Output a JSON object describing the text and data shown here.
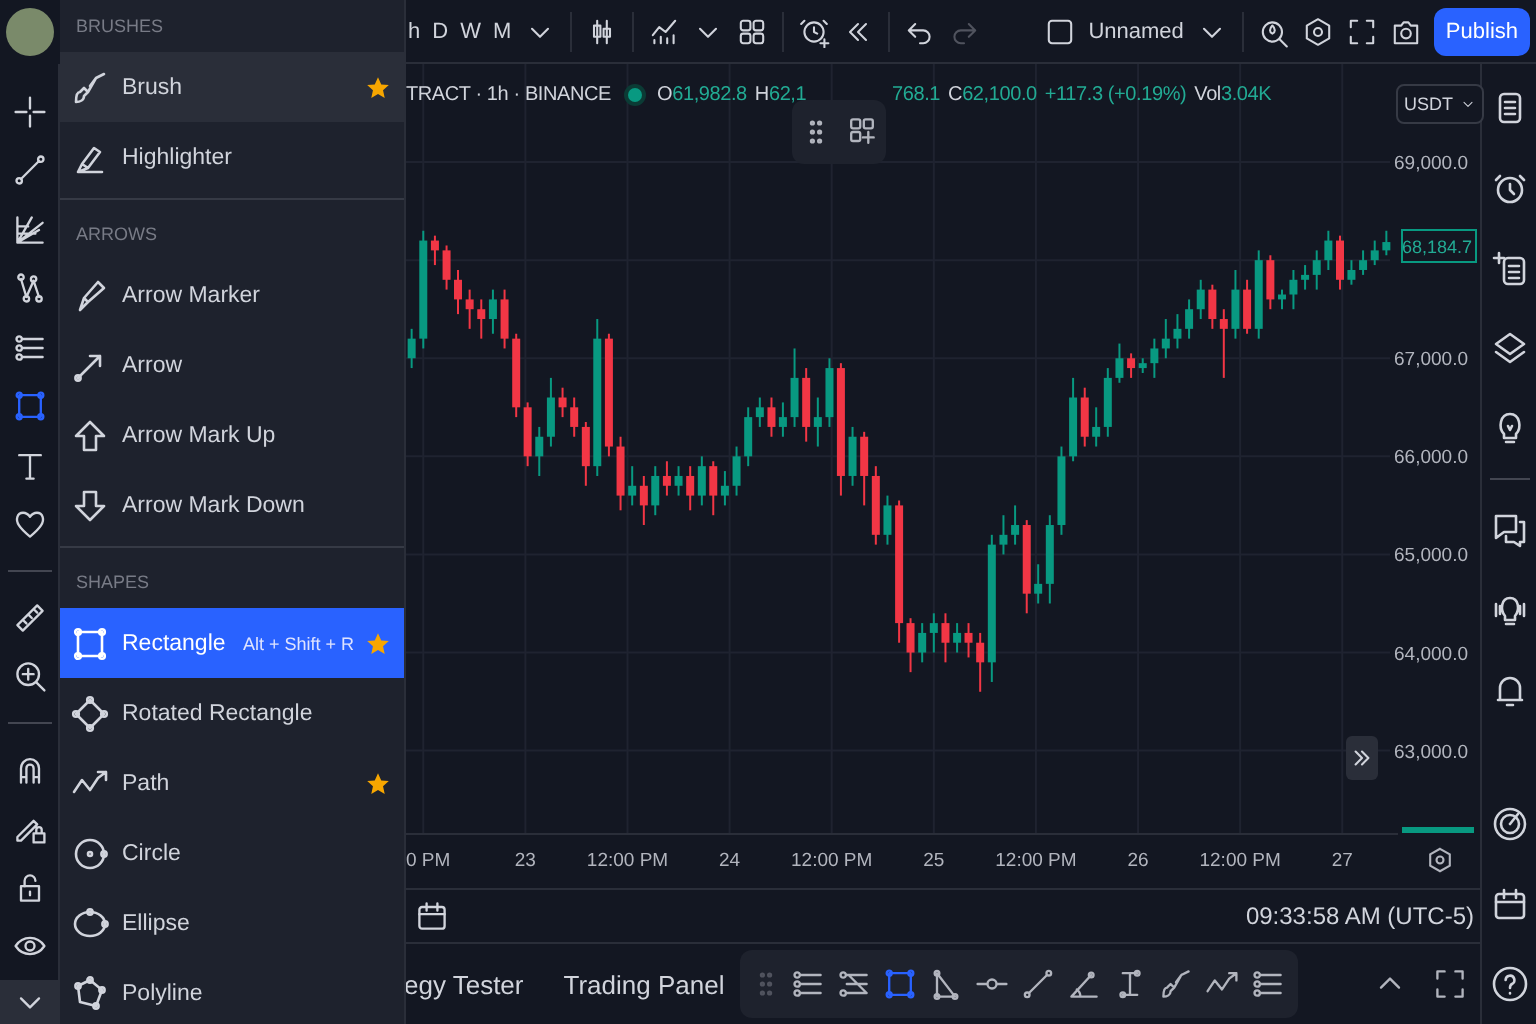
{
  "top_toolbar": {
    "intervals": [
      {
        "label": "h"
      },
      {
        "label": "D"
      },
      {
        "label": "W"
      },
      {
        "label": "M"
      }
    ],
    "history": [
      {
        "kind": "undo",
        "disabled": false
      },
      {
        "kind": "redo",
        "disabled": true
      }
    ],
    "layout_name": "Unnamed",
    "publish": "Publish"
  },
  "drawing_menu": {
    "sections": [
      {
        "title": "BRUSHES",
        "items": [
          {
            "label": "Brush",
            "favorite": true,
            "selected": false,
            "hovered": true
          },
          {
            "label": "Highlighter",
            "favorite": false,
            "selected": false,
            "hovered": false
          }
        ]
      },
      {
        "title": "ARROWS",
        "items": [
          {
            "label": "Arrow Marker",
            "favorite": false,
            "selected": false,
            "hovered": false
          },
          {
            "label": "Arrow",
            "favorite": false,
            "selected": false,
            "hovered": false
          },
          {
            "label": "Arrow Mark Up",
            "favorite": false,
            "selected": false,
            "hovered": false
          },
          {
            "label": "Arrow Mark Down",
            "favorite": false,
            "selected": false,
            "hovered": false
          }
        ]
      },
      {
        "title": "SHAPES",
        "items": [
          {
            "label": "Rectangle",
            "shortcut": "Alt + Shift + R",
            "favorite": true,
            "selected": true,
            "hovered": false
          },
          {
            "label": "Rotated Rectangle",
            "favorite": false,
            "selected": false,
            "hovered": false
          },
          {
            "label": "Path",
            "favorite": true,
            "selected": false,
            "hovered": false
          },
          {
            "label": "Circle",
            "favorite": false,
            "selected": false,
            "hovered": false
          },
          {
            "label": "Ellipse",
            "favorite": false,
            "selected": false,
            "hovered": false
          },
          {
            "label": "Polyline",
            "favorite": false,
            "selected": false,
            "hovered": false
          }
        ]
      }
    ]
  },
  "left_toolbar": {
    "tools": [
      {
        "selected": false
      },
      {
        "selected": false
      },
      {
        "selected": false
      },
      {
        "selected": false
      },
      {
        "selected": false
      },
      {
        "selected": true
      },
      {
        "selected": false
      },
      {
        "selected": false
      },
      {
        "selected": false
      },
      {
        "selected": false
      },
      {
        "selected": false
      },
      {
        "selected": false
      },
      {
        "selected": false
      },
      {
        "selected": false
      }
    ]
  },
  "legend": {
    "symbol": "TRACT · 1h · BINANCE",
    "fields_before": [
      {
        "label": "O",
        "value": "61,982.8"
      },
      {
        "label": "H",
        "value": "62,1"
      }
    ],
    "fields_after": [
      {
        "value": "768.1"
      },
      {
        "label": "C",
        "value": "62,100.0"
      },
      {
        "value": "+117.3 (+0.19%)"
      },
      {
        "label": "Vol",
        "value": "3.04K"
      }
    ]
  },
  "currency": "USDT",
  "last_price": "68,184.7",
  "chart": {
    "chart_data": {
      "type": "candlestick",
      "x": [
        22.443,
        22.5,
        22.557,
        22.614,
        22.67,
        22.727,
        22.784,
        22.841,
        22.898,
        22.955,
        23.011,
        23.068,
        23.125,
        23.182,
        23.239,
        23.296,
        23.352,
        23.409,
        23.466,
        23.523,
        23.58,
        23.636,
        23.693,
        23.75,
        23.807,
        23.864,
        23.92,
        23.977,
        24.034,
        24.091,
        24.148,
        24.205,
        24.261,
        24.318,
        24.375,
        24.432,
        24.489,
        24.545,
        24.602,
        24.659,
        24.716,
        24.773,
        24.83,
        24.886,
        24.943,
        25,
        25.057,
        25.114,
        25.17,
        25.227,
        25.284,
        25.341,
        25.398,
        25.455,
        25.511,
        25.568,
        25.625,
        25.682,
        25.739,
        25.795,
        25.852,
        25.909,
        25.966,
        26.023,
        26.08,
        26.136,
        26.193,
        26.25,
        26.307,
        26.364,
        26.42,
        26.477,
        26.534,
        26.591,
        26.648,
        26.705,
        26.761,
        26.818,
        26.875,
        26.932,
        26.989,
        27.045,
        27.102,
        27.159,
        27.216
      ],
      "ohlc": [
        [
          67000,
          67300,
          66900,
          67200
        ],
        [
          67200,
          68300,
          67100,
          68200
        ],
        [
          68200,
          68250,
          67950,
          68100
        ],
        [
          68100,
          68150,
          67700,
          67800
        ],
        [
          67800,
          67900,
          67450,
          67600
        ],
        [
          67600,
          67700,
          67300,
          67500
        ],
        [
          67500,
          67600,
          67200,
          67400
        ],
        [
          67400,
          67700,
          67250,
          67600
        ],
        [
          67600,
          67700,
          67100,
          67200
        ],
        [
          67200,
          67250,
          66400,
          66500
        ],
        [
          66500,
          66550,
          65900,
          66000
        ],
        [
          66000,
          66300,
          65800,
          66200
        ],
        [
          66200,
          66800,
          66100,
          66600
        ],
        [
          66600,
          66700,
          66400,
          66500
        ],
        [
          66500,
          66600,
          66200,
          66300
        ],
        [
          66300,
          66350,
          65700,
          65900
        ],
        [
          65900,
          67400,
          65800,
          67200
        ],
        [
          67200,
          67250,
          66000,
          66100
        ],
        [
          66100,
          66200,
          65450,
          65600
        ],
        [
          65600,
          65900,
          65500,
          65700
        ],
        [
          65700,
          65800,
          65300,
          65500
        ],
        [
          65500,
          65900,
          65400,
          65800
        ],
        [
          65800,
          65950,
          65600,
          65700
        ],
        [
          65700,
          65900,
          65600,
          65800
        ],
        [
          65800,
          65900,
          65450,
          65600
        ],
        [
          65600,
          66000,
          65500,
          65900
        ],
        [
          65900,
          65950,
          65400,
          65600
        ],
        [
          65600,
          65850,
          65500,
          65700
        ],
        [
          65700,
          66100,
          65600,
          66000
        ],
        [
          66000,
          66500,
          65900,
          66400
        ],
        [
          66400,
          66600,
          66300,
          66500
        ],
        [
          66500,
          66600,
          66200,
          66300
        ],
        [
          66300,
          66550,
          66200,
          66400
        ],
        [
          66400,
          67100,
          66300,
          66800
        ],
        [
          66800,
          66900,
          66150,
          66300
        ],
        [
          66300,
          66600,
          66100,
          66400
        ],
        [
          66400,
          67000,
          66300,
          66900
        ],
        [
          66900,
          66950,
          65600,
          65800
        ],
        [
          65800,
          66300,
          65700,
          66200
        ],
        [
          66200,
          66250,
          65500,
          65800
        ],
        [
          65800,
          65900,
          65100,
          65200
        ],
        [
          65200,
          65600,
          65100,
          65500
        ],
        [
          65500,
          65550,
          64100,
          64300
        ],
        [
          64300,
          64350,
          63800,
          64000
        ],
        [
          64000,
          64300,
          63900,
          64200
        ],
        [
          64200,
          64400,
          64000,
          64300
        ],
        [
          64300,
          64400,
          63900,
          64100
        ],
        [
          64100,
          64300,
          64000,
          64200
        ],
        [
          64200,
          64300,
          63950,
          64100
        ],
        [
          64100,
          64200,
          63600,
          63900
        ],
        [
          63900,
          65200,
          63700,
          65100
        ],
        [
          65100,
          65400,
          65000,
          65200
        ],
        [
          65200,
          65500,
          65100,
          65300
        ],
        [
          65300,
          65350,
          64400,
          64600
        ],
        [
          64600,
          64900,
          64500,
          64700
        ],
        [
          64700,
          65400,
          64500,
          65300
        ],
        [
          65300,
          66100,
          65200,
          66000
        ],
        [
          66000,
          66800,
          65950,
          66600
        ],
        [
          66600,
          66700,
          66100,
          66200
        ],
        [
          66200,
          66500,
          66100,
          66300
        ],
        [
          66300,
          66900,
          66200,
          66800
        ],
        [
          66800,
          67150,
          66750,
          67000
        ],
        [
          67000,
          67050,
          66800,
          66900
        ],
        [
          66900,
          67000,
          66850,
          66950
        ],
        [
          66950,
          67200,
          66800,
          67100
        ],
        [
          67100,
          67400,
          67000,
          67200
        ],
        [
          67200,
          67450,
          67100,
          67300
        ],
        [
          67300,
          67600,
          67200,
          67500
        ],
        [
          67500,
          67800,
          67400,
          67700
        ],
        [
          67700,
          67750,
          67300,
          67400
        ],
        [
          67400,
          67500,
          66800,
          67300
        ],
        [
          67300,
          67900,
          67200,
          67700
        ],
        [
          67700,
          67800,
          67250,
          67300
        ],
        [
          67300,
          68100,
          67200,
          68000
        ],
        [
          68000,
          68050,
          67500,
          67600
        ],
        [
          67600,
          67700,
          67500,
          67650
        ],
        [
          67650,
          67900,
          67500,
          67800
        ],
        [
          67800,
          67950,
          67700,
          67850
        ],
        [
          67850,
          68100,
          67700,
          68000
        ],
        [
          68000,
          68300,
          67900,
          68200
        ],
        [
          68200,
          68250,
          67700,
          67800
        ],
        [
          67800,
          68000,
          67750,
          67900
        ],
        [
          67900,
          68100,
          67850,
          68000
        ],
        [
          68000,
          68200,
          67950,
          68100
        ],
        [
          68100,
          68300,
          68050,
          68184.7
        ]
      ],
      "grid": true,
      "xlim": [
        22.386,
        27.273
      ],
      "ylim": [
        62150,
        70000
      ],
      "xticks": [
        {
          "value": 23,
          "label": "23"
        },
        {
          "value": 24,
          "label": "24"
        },
        {
          "value": 25,
          "label": "25"
        },
        {
          "value": 26,
          "label": "26"
        },
        {
          "value": 27,
          "label": "27"
        }
      ],
      "yticks": [
        {
          "value": 69000,
          "label": "69,000.0"
        },
        {
          "value": 67000,
          "label": "67,000.0"
        },
        {
          "value": 66000,
          "label": "66,000.0"
        },
        {
          "value": 65000,
          "label": "65,000.0"
        },
        {
          "value": 64000,
          "label": "64,000.0"
        },
        {
          "value": 63000,
          "label": "63,000.0"
        }
      ]
    }
  },
  "midday_labels": [
    "0 PM",
    "12:00 PM",
    "12:00 PM",
    "12:00 PM",
    "12:00 PM"
  ],
  "clock": "09:33:58 AM (UTC-5)",
  "bottom_tabs": [
    {
      "label": "egy Tester"
    },
    {
      "label": "Trading Panel"
    }
  ],
  "drawing_toolbar": {
    "tools": [
      {
        "selected": false
      },
      {
        "selected": false
      },
      {
        "selected": true
      },
      {
        "selected": false
      },
      {
        "selected": false
      },
      {
        "selected": false
      },
      {
        "selected": false
      },
      {
        "selected": false
      },
      {
        "selected": false
      },
      {
        "selected": false
      },
      {
        "selected": false
      }
    ]
  }
}
